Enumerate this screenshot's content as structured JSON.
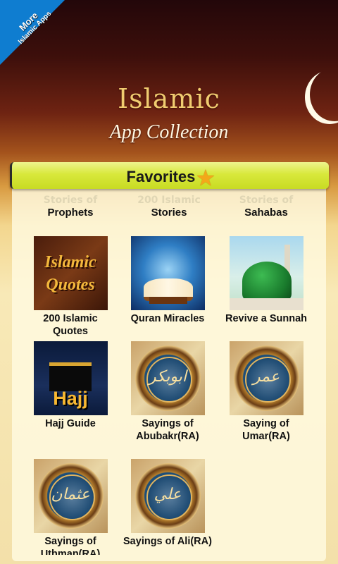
{
  "corner_badge": {
    "line1": "More",
    "line2": "Islamic Apps"
  },
  "header": {
    "title": "Islamic",
    "subtitle": "App Collection"
  },
  "favorites": {
    "title": "Favorites"
  },
  "partial_row": [
    {
      "label": "Prophets",
      "faded": "Stories of"
    },
    {
      "label": "Stories",
      "faded": "200 Islamic"
    },
    {
      "label": "Sahabas",
      "faded": "Stories of"
    }
  ],
  "apps": [
    {
      "label": "200 Islamic Quotes",
      "line1": "200 Islamic",
      "line2": "Quotes",
      "icon": "islamic-quotes-icon"
    },
    {
      "label": "Quran Miracles",
      "icon": "quran-miracles-icon"
    },
    {
      "label": "Revive a Sunnah",
      "icon": "revive-sunnah-icon"
    },
    {
      "label": "Hajj Guide",
      "icon": "hajj-guide-icon",
      "icon_text": "Hajj"
    },
    {
      "line1": "Sayings of",
      "line2": "Abubakr(RA)",
      "icon": "abubakr-calligraphy-icon"
    },
    {
      "line1": "Saying of",
      "line2": "Umar(RA)",
      "icon": "umar-calligraphy-icon"
    },
    {
      "line1": "Sayings of",
      "line2": "Uthman(RA)",
      "icon": "uthman-calligraphy-icon"
    },
    {
      "label": "Sayings of Ali(RA)",
      "icon": "ali-calligraphy-icon"
    }
  ],
  "quotes_icon_text": {
    "line1": "Islamic",
    "line2": "Quotes"
  },
  "calligraphy": {
    "abubakr": "ابوبكر",
    "umar": "عمر",
    "uthman": "عثمان",
    "ali": "علي"
  },
  "colors": {
    "favorites_bar": "#d8e83b",
    "title_gold": "#f0cc70",
    "corner_blue": "#0f7dd0"
  }
}
